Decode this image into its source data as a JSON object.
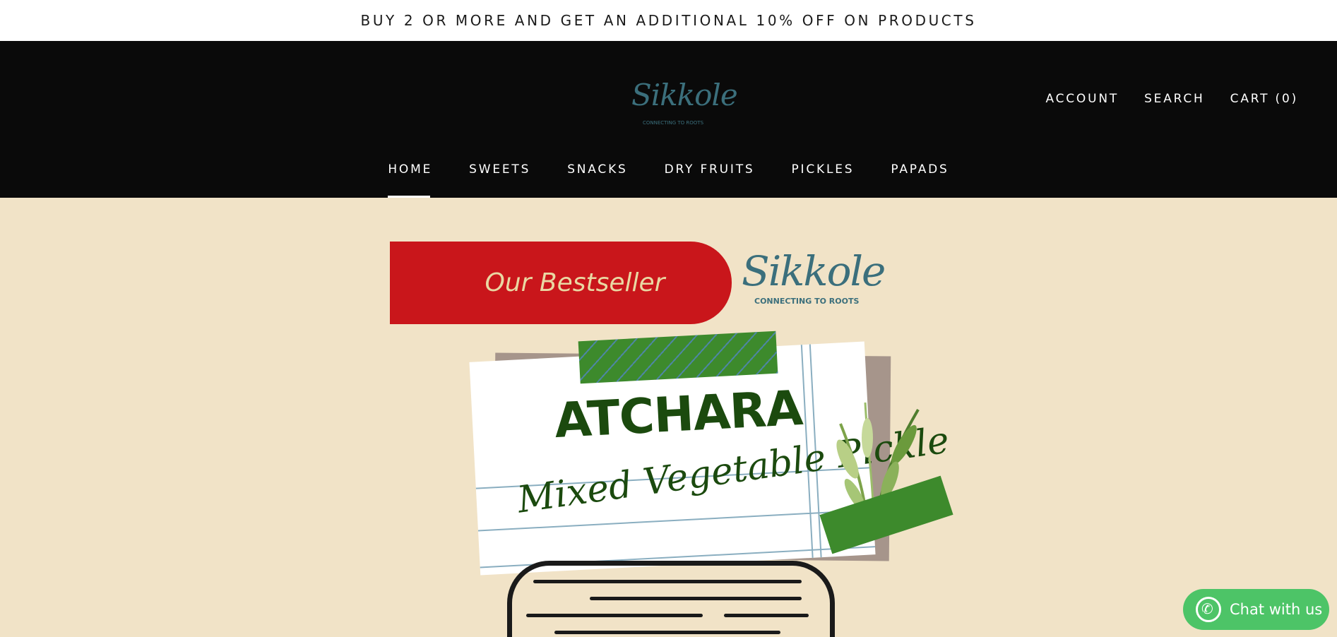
{
  "announcement": "BUY 2 OR MORE AND GET AN ADDITIONAL 10% OFF ON PRODUCTS",
  "header": {
    "logo_name": "Sikkole",
    "logo_tagline": "CONNECTING TO ROOTS",
    "links": {
      "account": "ACCOUNT",
      "search": "SEARCH",
      "cart": "CART (0)"
    }
  },
  "nav": {
    "items": [
      {
        "label": "HOME",
        "active": true
      },
      {
        "label": "SWEETS"
      },
      {
        "label": "SNACKS"
      },
      {
        "label": "DRY FRUITS"
      },
      {
        "label": "PICKLES"
      },
      {
        "label": "PAPADS"
      }
    ]
  },
  "hero": {
    "ribbon": "Our Bestseller",
    "brand": "Sikkole",
    "brand_tagline": "CONNECTING TO ROOTS",
    "title": "ATCHARA",
    "subtitle": "Mixed Vegetable Pickle"
  },
  "chat": {
    "label": "Chat with us",
    "icon": "whatsapp-icon"
  },
  "colors": {
    "header_bg": "#0a0a0a",
    "hero_bg": "#f1e3c7",
    "ribbon": "#c9161b",
    "brand_teal": "#3b6f7c",
    "pickle_green": "#1b4a0e",
    "chat_green": "#4dc467"
  }
}
